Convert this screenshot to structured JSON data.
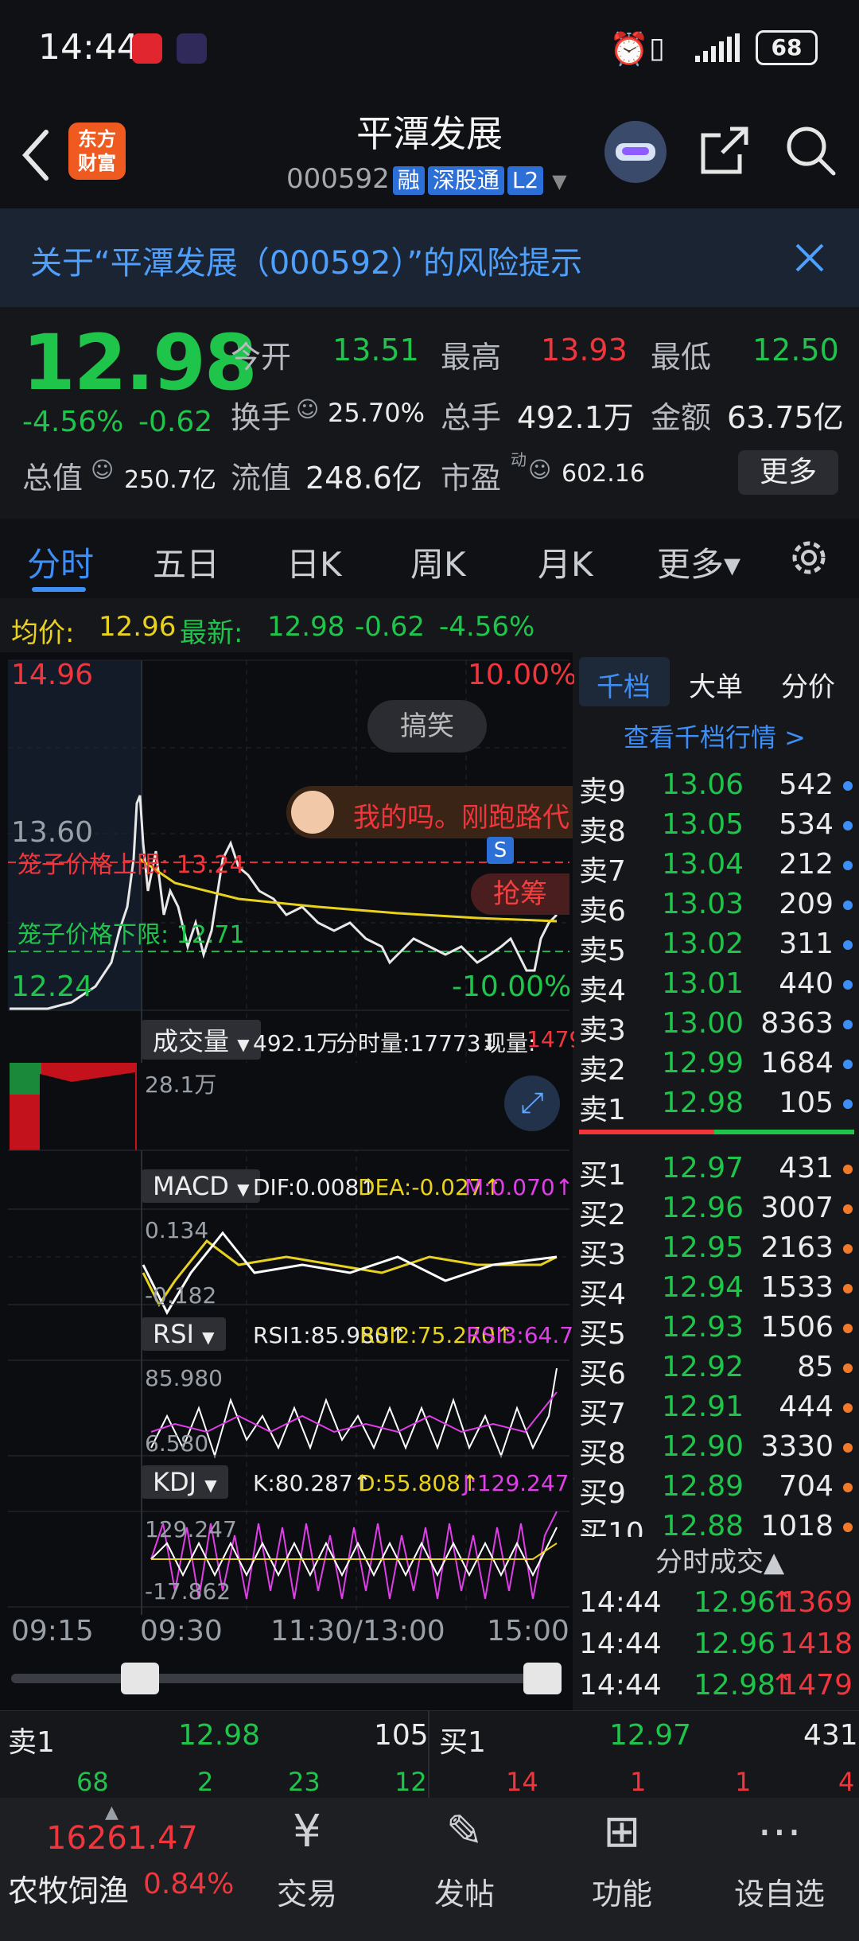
{
  "status_bar": {
    "time": "14:44",
    "battery": "68"
  },
  "header": {
    "app_logo_line1": "东方",
    "app_logo_line2": "财富",
    "stock_name": "平潭发展",
    "stock_code": "000592",
    "tag_margin": "融",
    "tag_connect": "深股通",
    "tag_level": "L2"
  },
  "risk_banner": {
    "text": "关于“平潭发展（000592）”的风险提示"
  },
  "quote": {
    "price": "12.98",
    "change_pct": "-4.56%",
    "change": "-0.62",
    "open_label": "今开",
    "open": "13.51",
    "high_label": "最高",
    "high": "13.93",
    "low_label": "最低",
    "low": "12.50",
    "turnover_label": "换手",
    "turnover": "25.70%",
    "volume_label": "总手",
    "volume": "492.1万",
    "amount_label": "金额",
    "amount": "63.75亿",
    "market_cap_label": "总值",
    "market_cap": "250.7亿",
    "float_cap_label": "流值",
    "float_cap": "248.6亿",
    "pe_label": "市盈",
    "pe_sup": "动",
    "pe": "602.16",
    "more_label": "更多"
  },
  "tabs": [
    "分时",
    "五日",
    "日K",
    "周K",
    "月K",
    "更多▾"
  ],
  "info_line": {
    "avg_label": "均价:",
    "avg": "12.96",
    "latest_label": "最新:",
    "latest": "12.98",
    "change": "-0.62",
    "change_pct": "-4.56%"
  },
  "chart": {
    "price_high": "14.96",
    "price_low": "12.24",
    "pct_high": "10.00%",
    "pct_low": "-10.00%",
    "level_1360": "13.60",
    "upper_cage_label": "笼子价格上限: 13.24",
    "lower_cage_label": "笼子价格下限: 12.71",
    "bubble_gaoxiao": "搞笑",
    "bubble_comment": "我的吗。刚跑路代",
    "grab_label": "抢筹",
    "s_marker": "S",
    "volume_label": "成交量",
    "volume_total": "492.1万",
    "volume_tick": "分时量:17773↓",
    "volume_now_label": "现量:",
    "volume_now": "1479",
    "volume_scale": "28.1万",
    "macd_label": "MACD",
    "macd_dif": "DIF:0.008↑",
    "macd_dea": "DEA:-0.027↑",
    "macd_m": "M:0.070↑",
    "macd_top": "0.134",
    "macd_bottom": "-0.182",
    "rsi_label": "RSI",
    "rsi1": "RSI1:85.980↑",
    "rsi2": "RSI2:75.270↑",
    "rsi3": "RSI3:64.770↑",
    "rsi_top": "85.980",
    "rsi_bottom": "6.580",
    "kdj_label": "KDJ",
    "kdj_k": "K:80.287↑",
    "kdj_d": "D:55.808↑",
    "kdj_j": "J:129.247↑",
    "kdj_top": "129.247",
    "kdj_bottom": "-17.862",
    "time_labels": [
      "09:15",
      "09:30",
      "11:30/13:00",
      "15:00"
    ]
  },
  "orderbook": {
    "tab_qiandang": "千档",
    "tab_dadan": "大单",
    "tab_fenjia": "分价",
    "view_link": "查看千档行情 >",
    "asks": [
      {
        "label": "卖9",
        "price": "13.06",
        "vol": "542"
      },
      {
        "label": "卖8",
        "price": "13.05",
        "vol": "534"
      },
      {
        "label": "卖7",
        "price": "13.04",
        "vol": "212"
      },
      {
        "label": "卖6",
        "price": "13.03",
        "vol": "209"
      },
      {
        "label": "卖5",
        "price": "13.02",
        "vol": "311"
      },
      {
        "label": "卖4",
        "price": "13.01",
        "vol": "440"
      },
      {
        "label": "卖3",
        "price": "13.00",
        "vol": "8363"
      },
      {
        "label": "卖2",
        "price": "12.99",
        "vol": "1684"
      },
      {
        "label": "卖1",
        "price": "12.98",
        "vol": "105"
      }
    ],
    "bids": [
      {
        "label": "买1",
        "price": "12.97",
        "vol": "431"
      },
      {
        "label": "买2",
        "price": "12.96",
        "vol": "3007"
      },
      {
        "label": "买3",
        "price": "12.95",
        "vol": "2163"
      },
      {
        "label": "买4",
        "price": "12.94",
        "vol": "1533"
      },
      {
        "label": "买5",
        "price": "12.93",
        "vol": "1506"
      },
      {
        "label": "买6",
        "price": "12.92",
        "vol": "85"
      },
      {
        "label": "买7",
        "price": "12.91",
        "vol": "444"
      },
      {
        "label": "买8",
        "price": "12.90",
        "vol": "3330"
      },
      {
        "label": "买9",
        "price": "12.89",
        "vol": "704"
      },
      {
        "label": "买10",
        "price": "12.88",
        "vol": "1018"
      }
    ],
    "trades_title": "分时成交▲",
    "trades": [
      {
        "time": "14:44",
        "price": "12.96",
        "vol": "1369",
        "arrow": "↑"
      },
      {
        "time": "14:44",
        "price": "12.96",
        "vol": "1418",
        "arrow": ""
      },
      {
        "time": "14:44",
        "price": "12.98",
        "vol": "1479",
        "arrow": "↑"
      }
    ]
  },
  "bottom_ticker": {
    "ask1_label": "卖1",
    "ask1_price": "12.98",
    "ask1_vol": "105",
    "bid1_label": "买1",
    "bid1_price": "12.97",
    "bid1_vol": "431",
    "ask_row2": [
      "68",
      "2",
      "23",
      "12"
    ],
    "bid_row2": [
      "14",
      "1",
      "1",
      "4"
    ]
  },
  "bottom_nav": {
    "index_value": "16261.47",
    "index_name": "农牧饲渔",
    "index_change": "0.84%",
    "items": [
      "交易",
      "发帖",
      "功能",
      "设自选"
    ]
  },
  "colors": {
    "up": "#f0363c",
    "down": "#1fc44b",
    "accent": "#3d8ef5"
  }
}
